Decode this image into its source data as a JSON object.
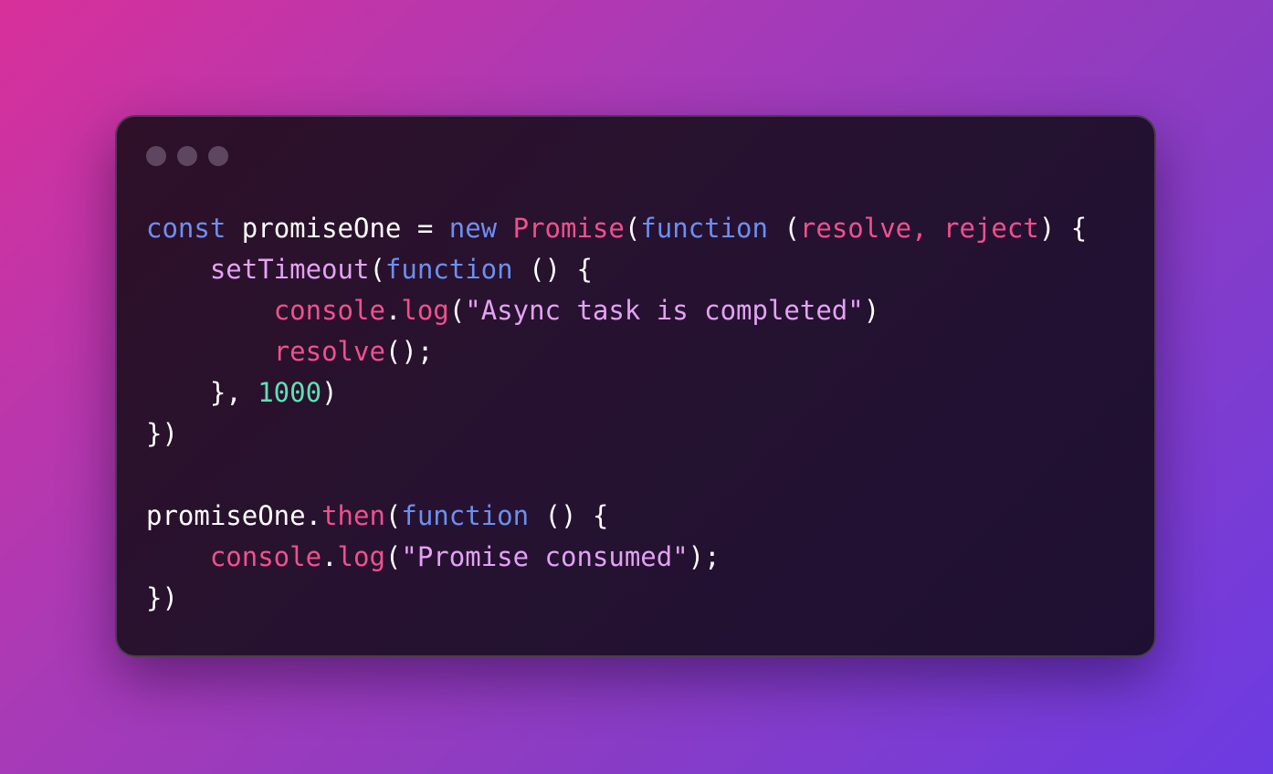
{
  "window": {
    "dots": [
      "dot",
      "dot",
      "dot"
    ]
  },
  "code": {
    "line1": {
      "t1": "const",
      "t2": " promiseOne = ",
      "t3": "new",
      "t4": " ",
      "t5": "Promise",
      "t6": "(",
      "t7": "function",
      "t8": " (",
      "t9": "resolve, reject",
      "t10": ") {"
    },
    "line2": {
      "t1": "    ",
      "t2": "setTimeout",
      "t3": "(",
      "t4": "function",
      "t5": " () {"
    },
    "line3": {
      "t1": "        ",
      "t2": "console",
      "t3": ".",
      "t4": "log",
      "t5": "(",
      "t6": "\"Async task is completed\"",
      "t7": ")"
    },
    "line4": {
      "t1": "        ",
      "t2": "resolve",
      "t3": "();"
    },
    "line5": {
      "t1": "    }, ",
      "t2": "1000",
      "t3": ")"
    },
    "line6": {
      "t1": "})"
    },
    "line7": {
      "t1": ""
    },
    "line8": {
      "t1": "promiseOne",
      "t2": ".",
      "t3": "then",
      "t4": "(",
      "t5": "function",
      "t6": " () {"
    },
    "line9": {
      "t1": "    ",
      "t2": "console",
      "t3": ".",
      "t4": "log",
      "t5": "(",
      "t6": "\"Promise consumed\"",
      "t7": ");"
    },
    "line10": {
      "t1": "})"
    }
  },
  "colors": {
    "keyword": "#6d8ff0",
    "class": "#f0508e",
    "parameter": "#f0508e",
    "function": "#e3a2f3",
    "string": "#e3a2f3",
    "number": "#5fe1b4",
    "text": "#ffffff"
  }
}
